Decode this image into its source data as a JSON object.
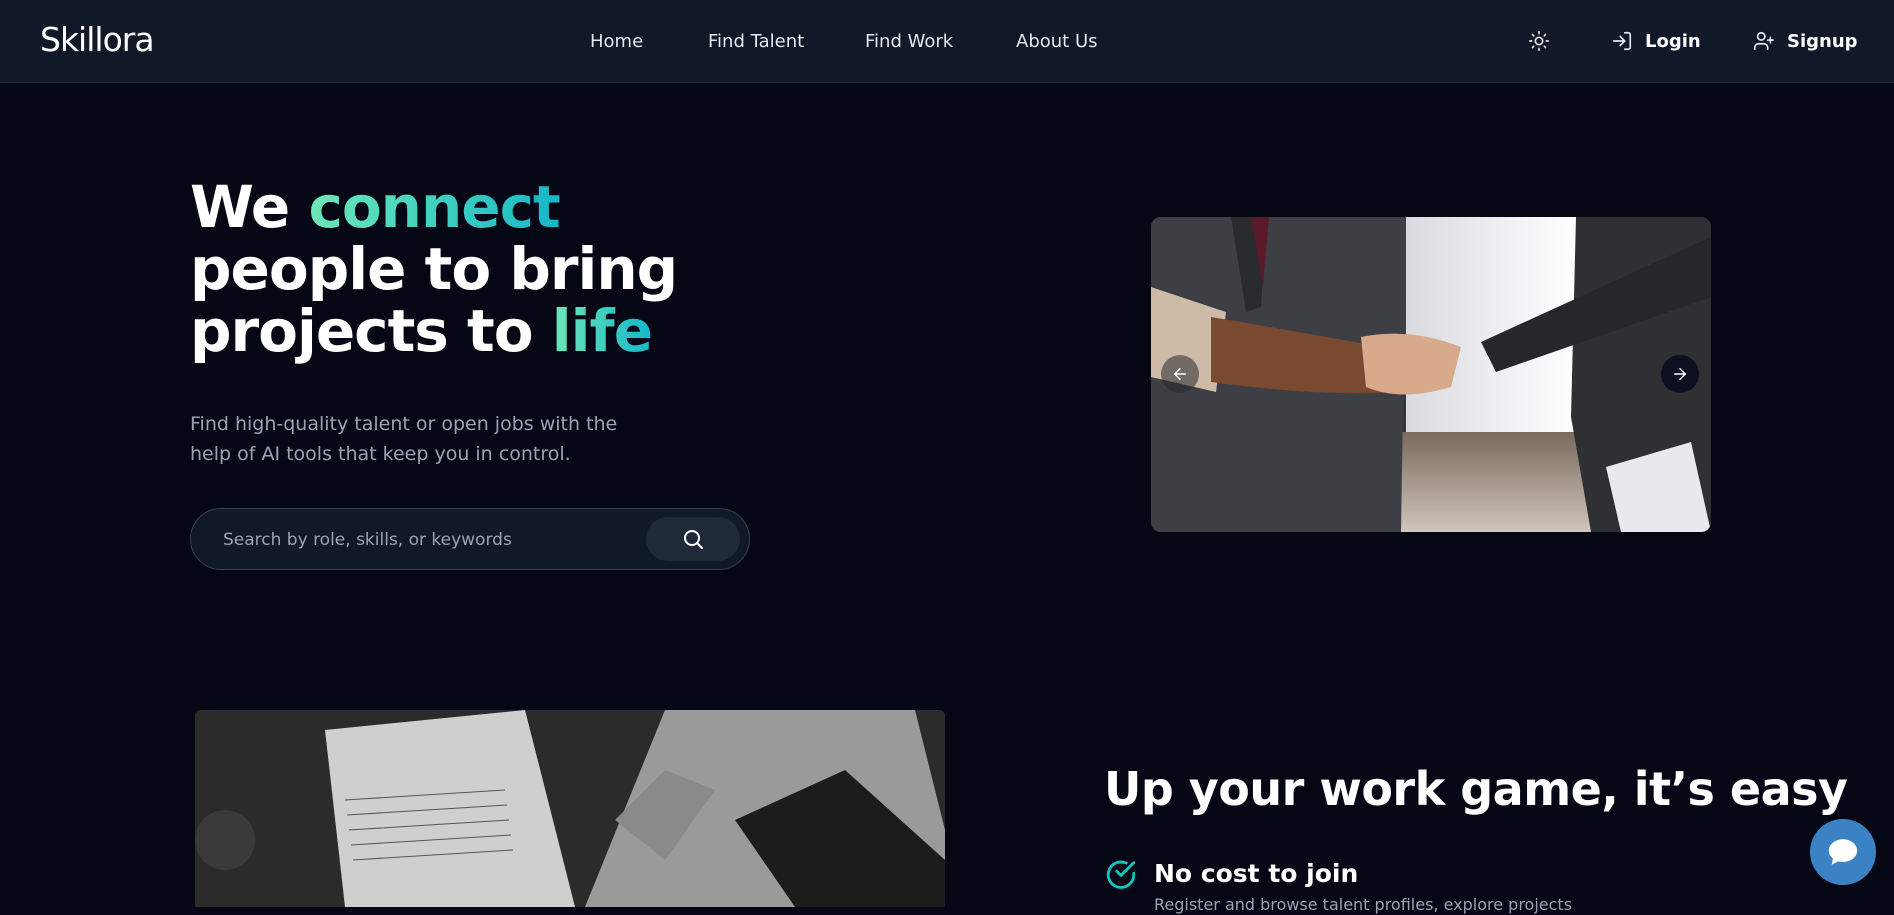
{
  "nav": {
    "logo": "Skillora",
    "links": [
      {
        "label": "Home"
      },
      {
        "label": "Find Talent"
      },
      {
        "label": "Find Work"
      },
      {
        "label": "About Us"
      }
    ],
    "login_label": "Login",
    "signup_label": "Signup",
    "icons": {
      "theme": "sun-icon",
      "login": "login-icon",
      "signup": "user-plus-icon"
    }
  },
  "hero": {
    "title": {
      "part1": "We ",
      "highlight1": "connect",
      "part2": "people to bring",
      "part3": "projects to ",
      "highlight2": "life"
    },
    "subtitle": "Find high-quality talent or open jobs with the help of AI tools that keep you in control.",
    "search": {
      "placeholder": "Search by role, skills, or keywords",
      "value": ""
    }
  },
  "features": {
    "title": "Up your work game, it’s easy",
    "items": [
      {
        "title": "No cost to join",
        "description": "Register and browse talent profiles, explore projects"
      }
    ]
  },
  "colors": {
    "background": "#050814",
    "navbar": "#111827",
    "accent_start": "#6ee7b7",
    "accent_end": "#14b8c8",
    "chat_button": "#3b82c4"
  }
}
